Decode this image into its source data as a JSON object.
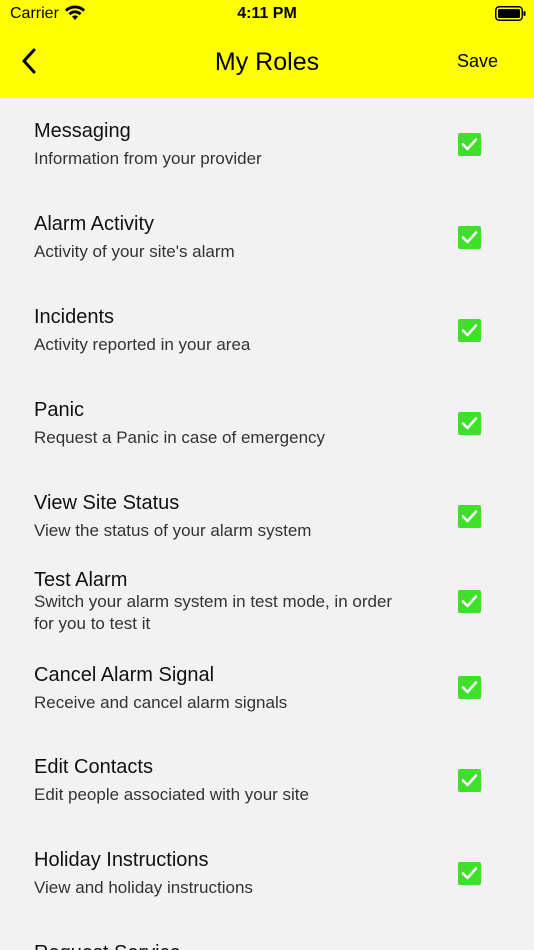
{
  "status_bar": {
    "carrier": "Carrier",
    "time": "4:11 PM"
  },
  "nav": {
    "title": "My Roles",
    "save_label": "Save"
  },
  "colors": {
    "header_bg": "#ffff00",
    "check_bg": "#3fe02a",
    "page_bg": "#f2f2f2"
  },
  "roles": [
    {
      "title": "Messaging",
      "description": "Information from your provider",
      "checked": true
    },
    {
      "title": "Alarm Activity",
      "description": "Activity of your site's alarm",
      "checked": true
    },
    {
      "title": "Incidents",
      "description": "Activity reported in your area",
      "checked": true
    },
    {
      "title": "Panic",
      "description": "Request a Panic in case of emergency",
      "checked": true
    },
    {
      "title": "View Site Status",
      "description": "View the status of your alarm system",
      "checked": true
    },
    {
      "title": "Test Alarm",
      "description": "Switch your alarm system in test mode,  in order for you to test it",
      "checked": true
    },
    {
      "title": "Cancel Alarm Signal",
      "description": "Receive and cancel alarm signals",
      "checked": true
    },
    {
      "title": "Edit Contacts",
      "description": "Edit people associated with your site",
      "checked": true
    },
    {
      "title": "Holiday Instructions",
      "description": "View and holiday instructions",
      "checked": true
    },
    {
      "title": "Request Service",
      "description": "",
      "checked": false
    }
  ]
}
